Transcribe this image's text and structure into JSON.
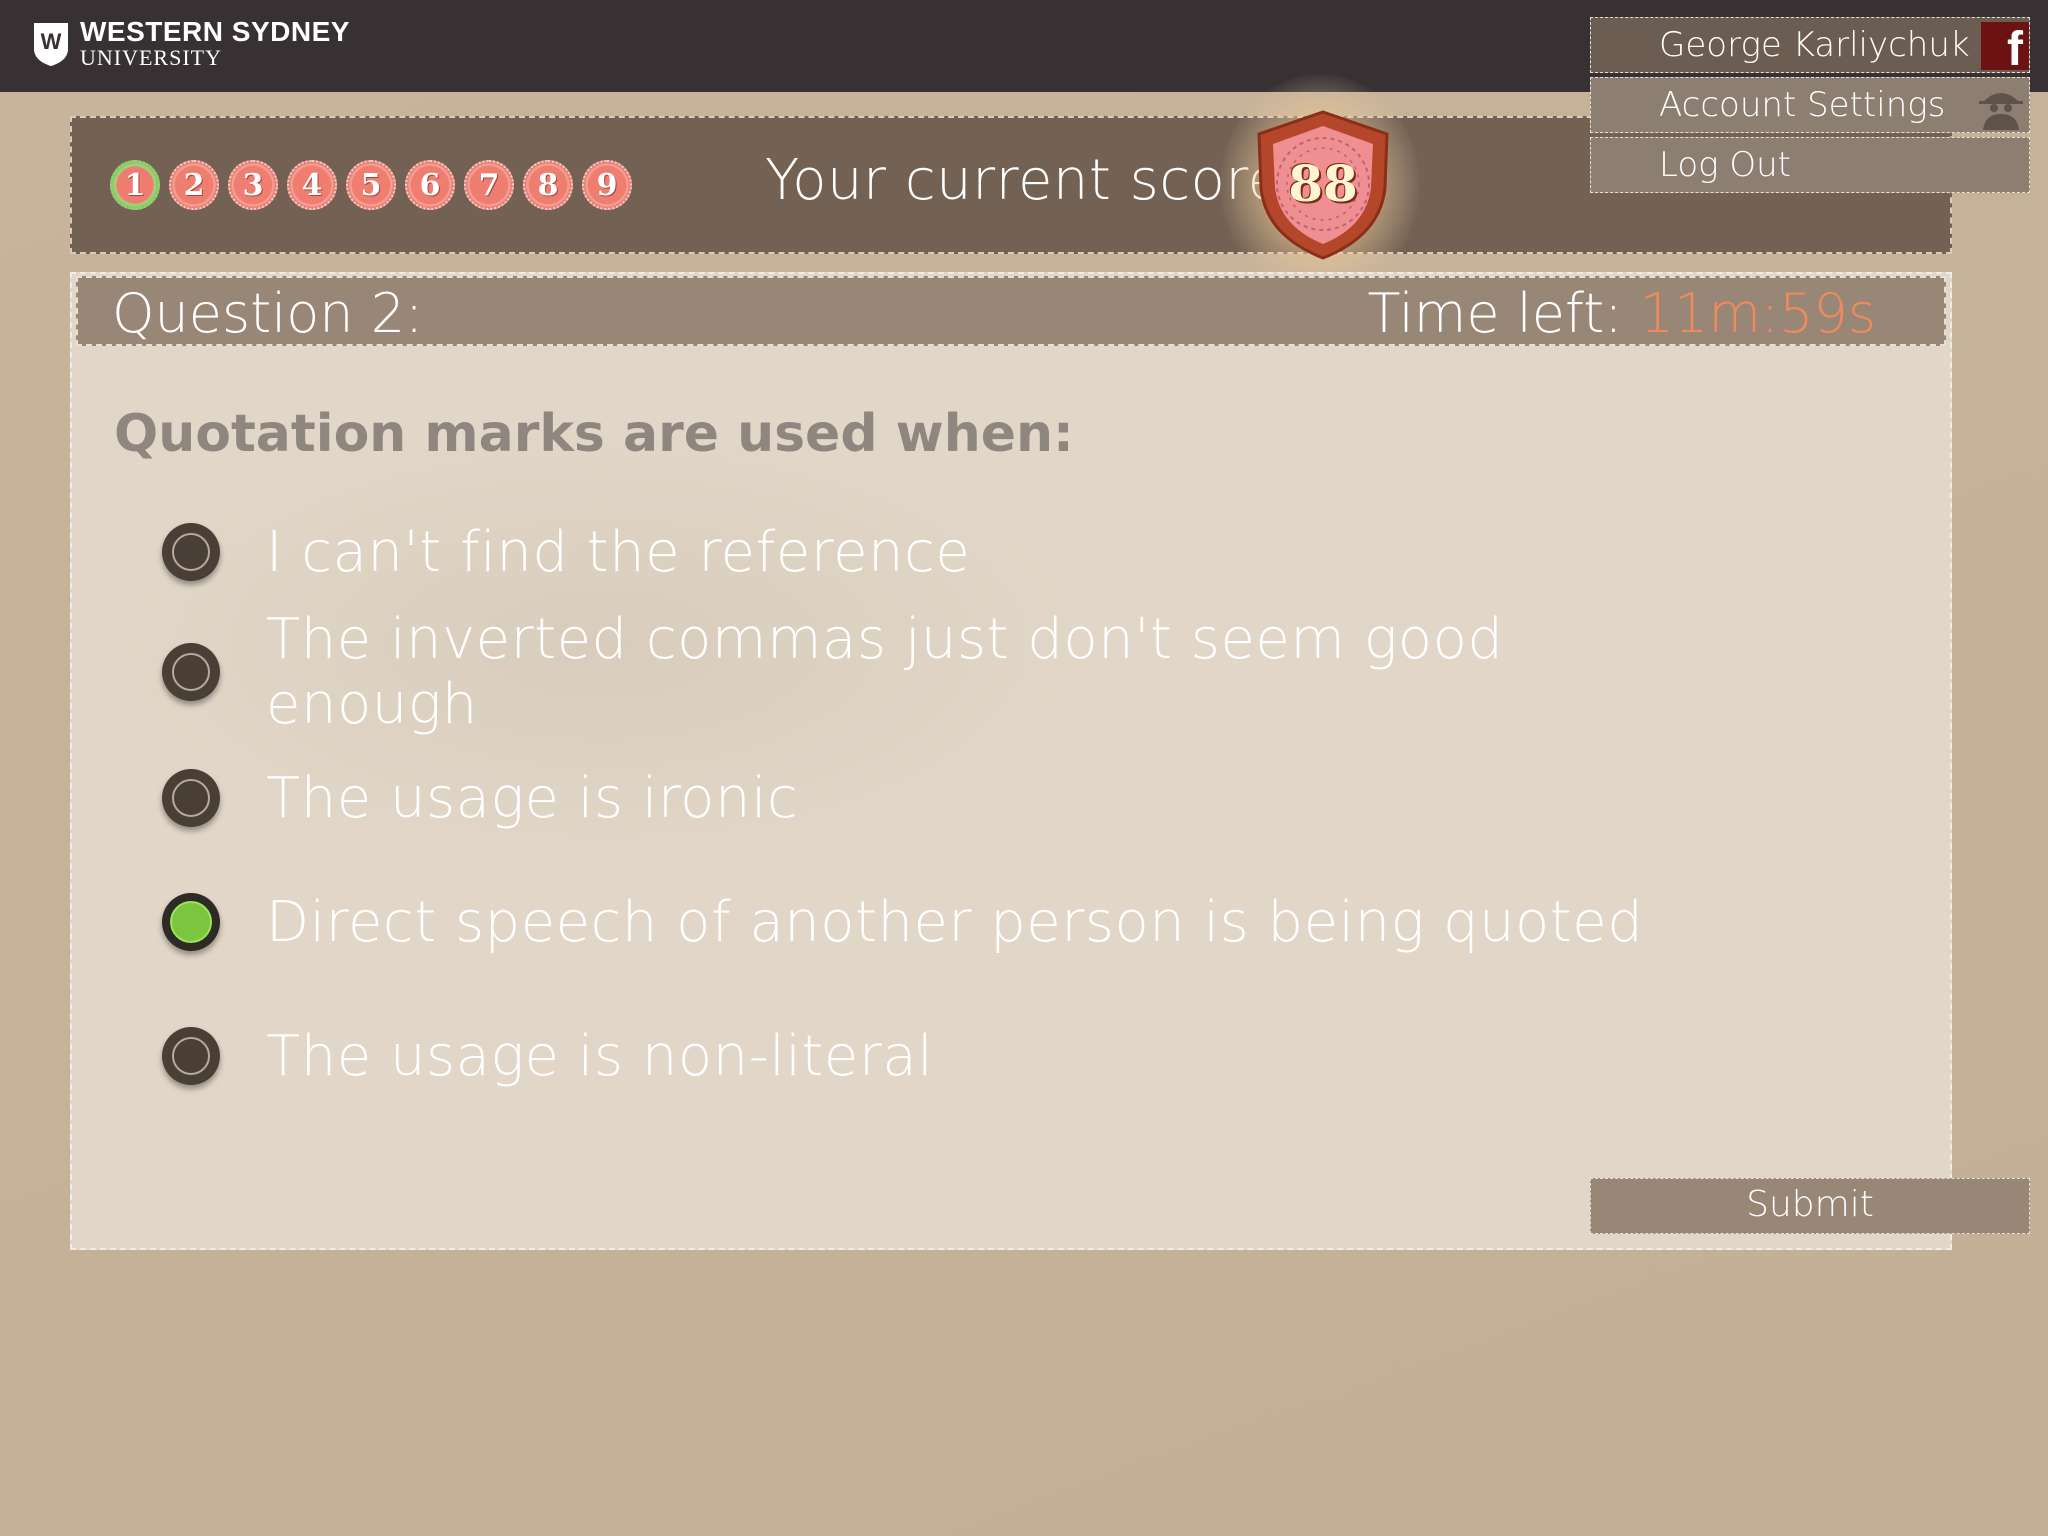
{
  "header": {
    "logo_line1": "WESTERN SYDNEY",
    "logo_line2": "UNIVERSITY",
    "logo_icon": "university-shield-icon"
  },
  "account_menu": {
    "user_name": "George Karliychuk",
    "settings_label": "Account Settings",
    "logout_label": "Log Out",
    "facebook_icon": "facebook-icon",
    "profile_icon": "spy-avatar-icon"
  },
  "progress": {
    "steps": [
      "1",
      "2",
      "3",
      "4",
      "5",
      "6",
      "7",
      "8",
      "9"
    ],
    "completed_steps": 1,
    "score_label": "Your current score:",
    "score_value": "88"
  },
  "question": {
    "title": "Question 2:",
    "time_label": "Time left:",
    "time_value": "11m:59s",
    "prompt": "Quotation marks are used when:",
    "options": [
      {
        "label": "I can't find the reference",
        "selected": false
      },
      {
        "label": "The inverted commas just don't seem good enough",
        "selected": false
      },
      {
        "label": "The usage is ironic",
        "selected": false
      },
      {
        "label": "Direct speech of another person is being quoted",
        "selected": true
      },
      {
        "label": "The usage is non-literal",
        "selected": false
      }
    ]
  },
  "actions": {
    "submit_label": "Submit"
  },
  "colors": {
    "topbar": "#373134",
    "background": "#c6b298",
    "accent_timer": "#ee8a5e",
    "selected_radio": "#7bc63e"
  }
}
